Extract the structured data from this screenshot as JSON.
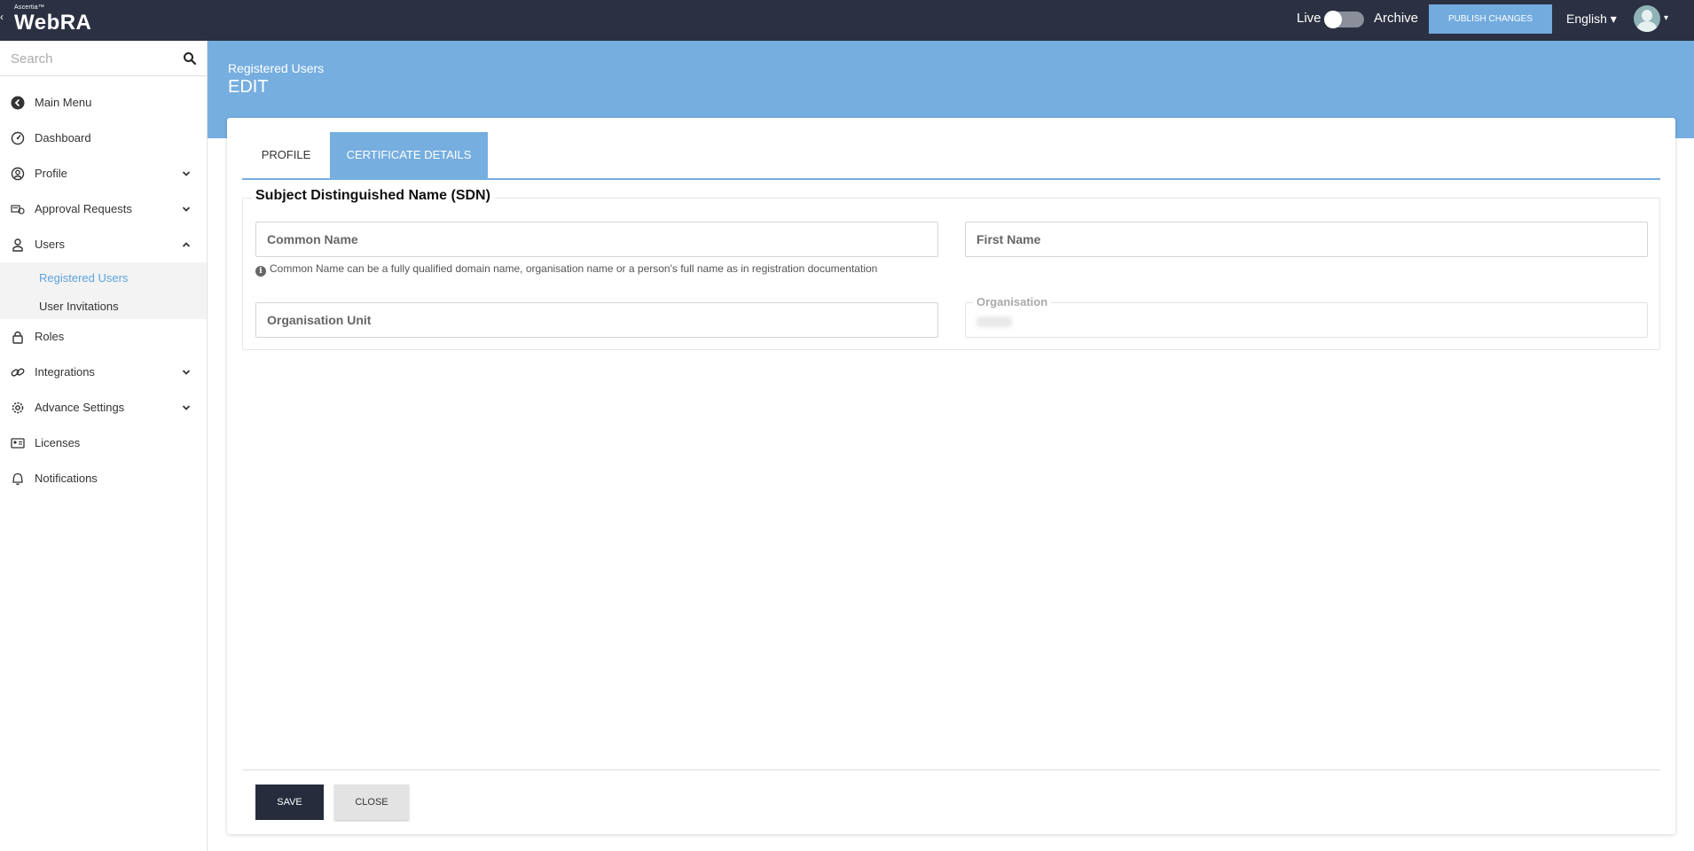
{
  "topbar": {
    "brand_small": "Ascertia™",
    "brand_main": "WebRA",
    "live_label": "Live",
    "archive_label": "Archive",
    "publish_label": "PUBLISH CHANGES",
    "language": "English ▾",
    "avatar_caret": "▾"
  },
  "sidebar": {
    "search_placeholder": "Search",
    "items": [
      {
        "label": "Main Menu",
        "icon": "back-circle-icon"
      },
      {
        "label": "Dashboard",
        "icon": "dashboard-icon"
      },
      {
        "label": "Profile",
        "icon": "user-circle-icon"
      },
      {
        "label": "Approval Requests",
        "icon": "approval-icon"
      },
      {
        "label": "Users",
        "icon": "users-icon"
      },
      {
        "label": "Roles",
        "icon": "lock-icon"
      },
      {
        "label": "Integrations",
        "icon": "link-icon"
      },
      {
        "label": "Advance Settings",
        "icon": "gear-icon"
      },
      {
        "label": "Licenses",
        "icon": "license-icon"
      },
      {
        "label": "Notifications",
        "icon": "bell-icon"
      }
    ],
    "sub_items": [
      {
        "label": "Registered Users",
        "active": true
      },
      {
        "label": "User Invitations",
        "active": false
      }
    ]
  },
  "header": {
    "breadcrumb": "Registered Users",
    "title": "EDIT"
  },
  "tabs": [
    {
      "label": "PROFILE",
      "active": false
    },
    {
      "label": "CERTIFICATE DETAILS",
      "active": true
    }
  ],
  "sdn": {
    "legend": "Subject Distinguished Name (SDN)",
    "common_name_label": "Common Name",
    "first_name_label": "First Name",
    "hint": "Common Name can be a fully qualified domain name, organisation name or a person's full name as in registration documentation",
    "org_unit_label": "Organisation Unit",
    "organisation_label": "Organisation"
  },
  "actions": {
    "save_label": "SAVE",
    "close_label": "CLOSE"
  },
  "colors": {
    "topbar": "#2b3142",
    "accent": "#76aedf",
    "save_button": "#262c3c"
  }
}
